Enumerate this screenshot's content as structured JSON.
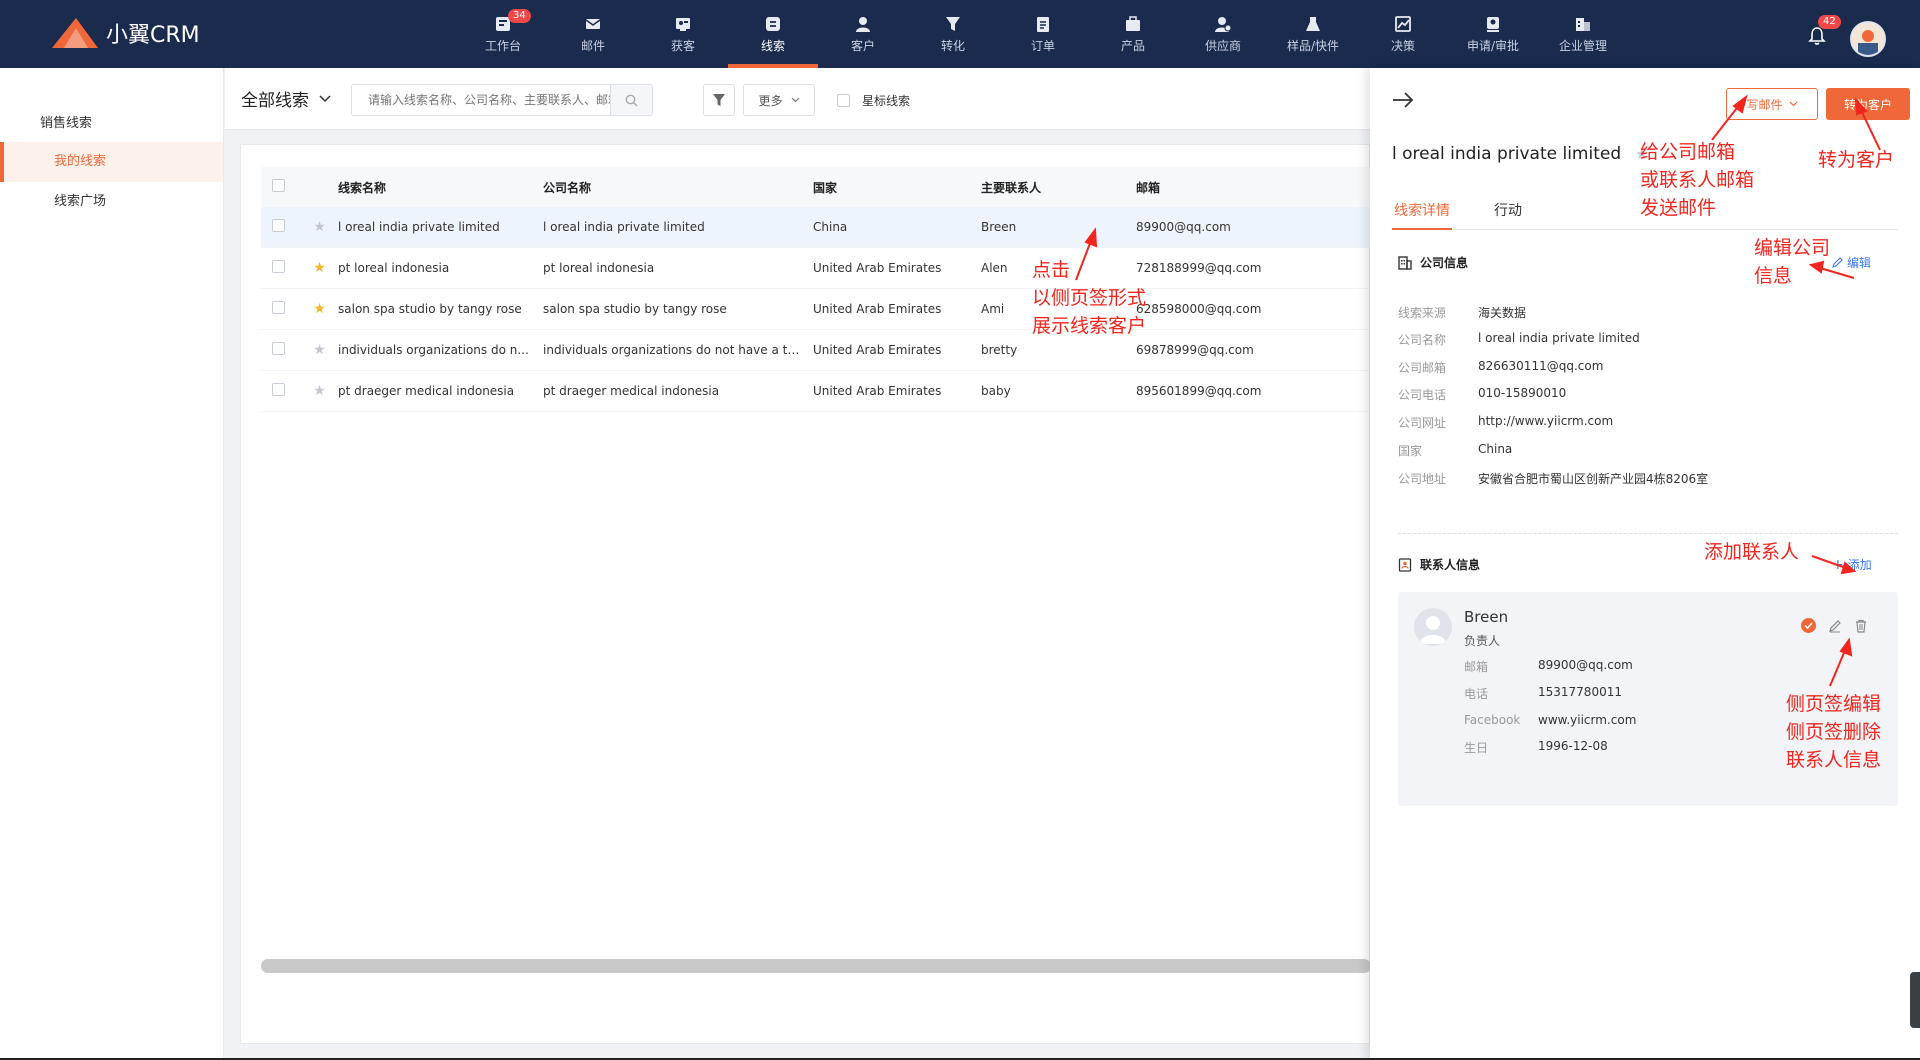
{
  "app": {
    "name": "小翼CRM"
  },
  "nav": {
    "items": [
      {
        "label": "工作台",
        "icon": "dashboard-icon",
        "badge": "34"
      },
      {
        "label": "邮件",
        "icon": "mail-icon"
      },
      {
        "label": "获客",
        "icon": "acquire-icon"
      },
      {
        "label": "线索",
        "icon": "leads-icon",
        "active": true
      },
      {
        "label": "客户",
        "icon": "customer-icon"
      },
      {
        "label": "转化",
        "icon": "funnel-icon"
      },
      {
        "label": "订单",
        "icon": "order-icon"
      },
      {
        "label": "产品",
        "icon": "product-icon"
      },
      {
        "label": "供应商",
        "icon": "supplier-icon"
      },
      {
        "label": "样品/快件",
        "icon": "sample-icon"
      },
      {
        "label": "决策",
        "icon": "decision-icon"
      },
      {
        "label": "申请/审批",
        "icon": "approval-icon"
      },
      {
        "label": "企业管理",
        "icon": "enterprise-icon"
      }
    ],
    "notification_badge": "42"
  },
  "sidebar": {
    "group": "销售线索",
    "items": [
      {
        "label": "我的线索",
        "active": true
      },
      {
        "label": "线索广场"
      }
    ]
  },
  "toolbar": {
    "view_label": "全部线索",
    "search_placeholder": "请输入线索名称、公司名称、主要联系人、邮箱",
    "more_label": "更多",
    "star_filter_label": "星标线索"
  },
  "table": {
    "columns": [
      "线索名称",
      "公司名称",
      "国家",
      "主要联系人",
      "邮箱"
    ],
    "rows": [
      {
        "name": "l oreal india private limited",
        "company": "l oreal india private limited",
        "country": "China",
        "contact": "Breen",
        "email": "89900@qq.com",
        "starred": false,
        "selected": true
      },
      {
        "name": "pt loreal indonesia",
        "company": "pt loreal indonesia",
        "country": "United Arab Emirates",
        "contact": "Alen",
        "email": "728188999@qq.com",
        "starred": true
      },
      {
        "name": "salon spa studio by tangy rose",
        "company": "salon spa studio by tangy rose",
        "country": "United Arab Emirates",
        "contact": "Ami",
        "email": "628598000@qq.com",
        "starred": true
      },
      {
        "name": "individuals organizations do n...",
        "company": "individuals organizations do not have a ta...",
        "country": "United Arab Emirates",
        "contact": "bretty",
        "email": "69878999@qq.com",
        "starred": false
      },
      {
        "name": "pt draeger medical indonesia",
        "company": "pt draeger medical indonesia",
        "country": "United Arab Emirates",
        "contact": "baby",
        "email": "895601899@qq.com",
        "starred": false
      }
    ]
  },
  "drawer": {
    "write_mail_label": "写邮件",
    "convert_label": "转为客户",
    "title": "l oreal india private limited",
    "tabs": [
      "线索详情",
      "行动"
    ],
    "company_section": {
      "title": "公司信息",
      "edit_label": "编辑",
      "fields": [
        {
          "k": "线索来源",
          "v": "海关数据"
        },
        {
          "k": "公司名称",
          "v": "l oreal india private limited"
        },
        {
          "k": "公司邮箱",
          "v": "826630111@qq.com"
        },
        {
          "k": "公司电话",
          "v": "010-15890010"
        },
        {
          "k": "公司网址",
          "v": "http://www.yiicrm.com"
        },
        {
          "k": "国家",
          "v": "China"
        },
        {
          "k": "公司地址",
          "v": "安徽省合肥市蜀山区创新产业园4栋8206室"
        }
      ]
    },
    "contact_section": {
      "title": "联系人信息",
      "add_label": "添加",
      "contact": {
        "name": "Breen",
        "role": "负责人",
        "fields": [
          {
            "k": "邮箱",
            "v": "89900@qq.com"
          },
          {
            "k": "电话",
            "v": "15317780011"
          },
          {
            "k": "Facebook",
            "v": "www.yiicrm.com"
          },
          {
            "k": "生日",
            "v": "1996-12-08"
          }
        ]
      }
    }
  },
  "annotations": {
    "click_drawer": [
      "点击",
      "以侧页签形式",
      "展示线索客户"
    ],
    "send_mail": [
      "给公司邮箱",
      "或联系人邮箱",
      "发送邮件"
    ],
    "convert": [
      "转为客户"
    ],
    "edit_company": [
      "编辑公司",
      "信息"
    ],
    "add_contact": [
      "添加联系人"
    ],
    "edit_delete": [
      "侧页签编辑",
      "侧页签删除",
      "联系人信息"
    ]
  },
  "colors": {
    "nav_bg": "#1a2b4e",
    "accent": "#f0683a",
    "annotation": "#f2261e",
    "link": "#3a7afe"
  }
}
